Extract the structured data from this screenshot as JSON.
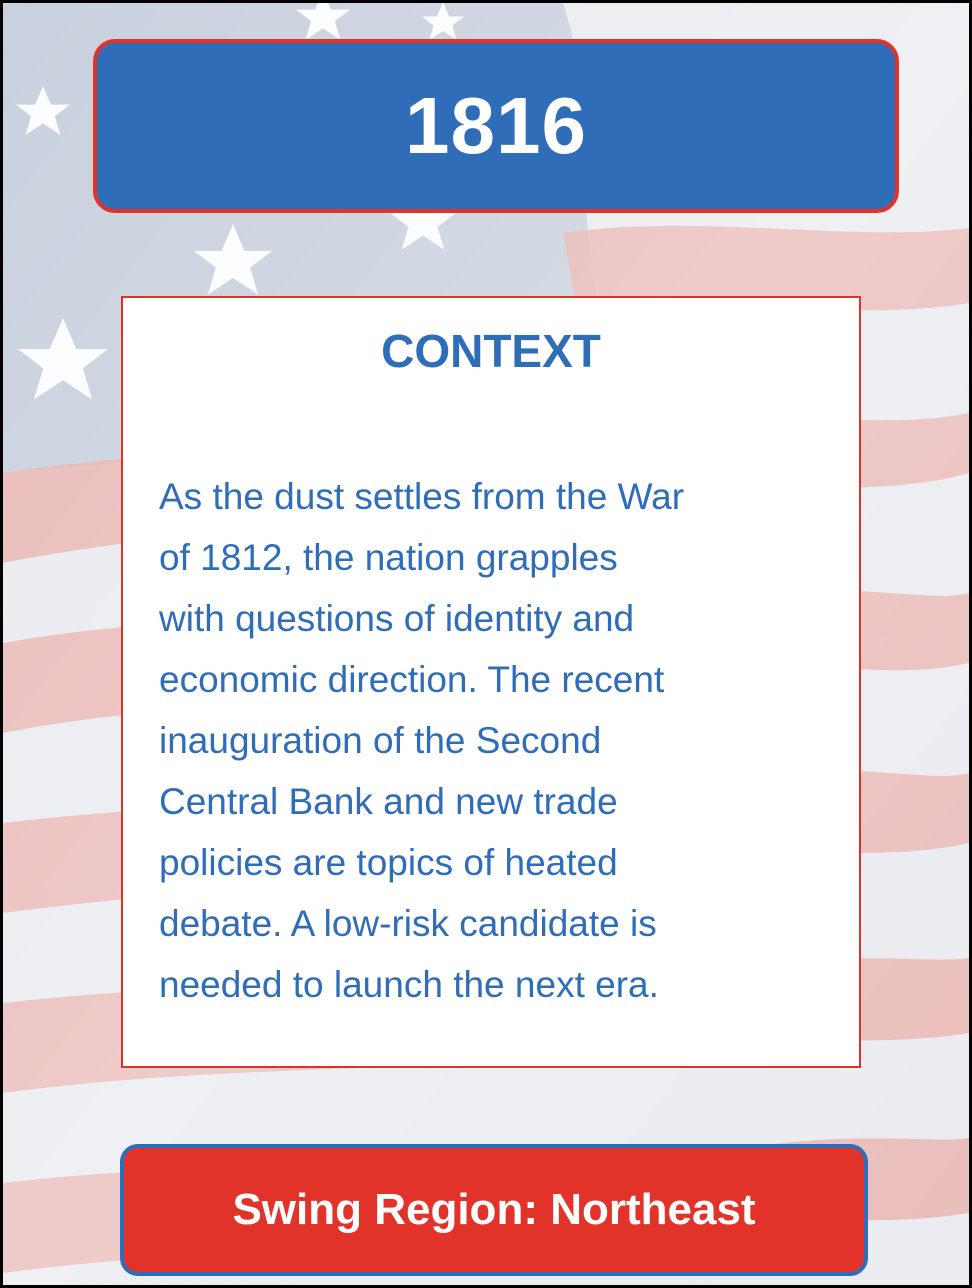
{
  "card": {
    "year": "1816",
    "context_title": "CONTEXT",
    "context_lines": [
      "As the dust settles from the War",
      "of 1812, the nation grapples",
      "with questions of identity and",
      "economic direction. The recent",
      "inauguration of the Second",
      "Central Bank and new trade",
      "policies are topics of heated",
      "debate. A low-risk candidate is",
      "needed to launch the next era."
    ],
    "region": "Swing Region: Northeast"
  },
  "colors": {
    "blue": "#2f6db8",
    "red": "#e2332a",
    "white": "#ffffff"
  },
  "background": {
    "icon": "american-flag-icon"
  }
}
